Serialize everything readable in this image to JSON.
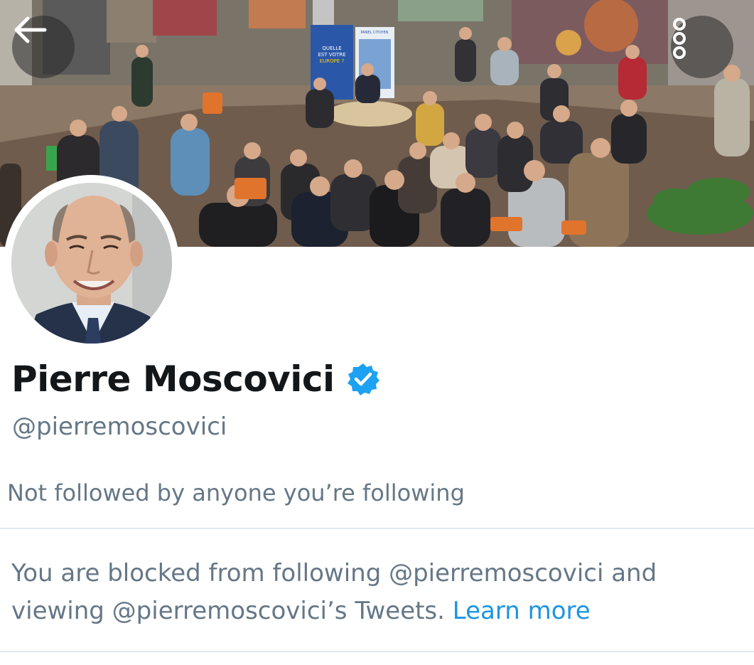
{
  "header": {
    "back_icon": "arrow-left-icon",
    "more_icon": "more-vertical-icon"
  },
  "banner": {
    "poster_lines": [
      "QUELLE",
      "EST VOTRE",
      "EUROPE ?"
    ],
    "poster_right": "PANEL CITOYEN"
  },
  "profile": {
    "name": "Pierre Moscovici",
    "verified": true,
    "verified_color": "#1da1f2",
    "handle": "@pierremoscovici",
    "followers_note": "Not followed by anyone you’re following"
  },
  "blocked_notice": {
    "text": "You are blocked from following @pierremoscovici and viewing @pierremoscovici’s Tweets.",
    "link_label": "Learn more",
    "link_color": "#1b95e0"
  },
  "colors": {
    "text_primary": "#14171a",
    "text_secondary": "#657786",
    "divider": "#e1e8ed"
  }
}
